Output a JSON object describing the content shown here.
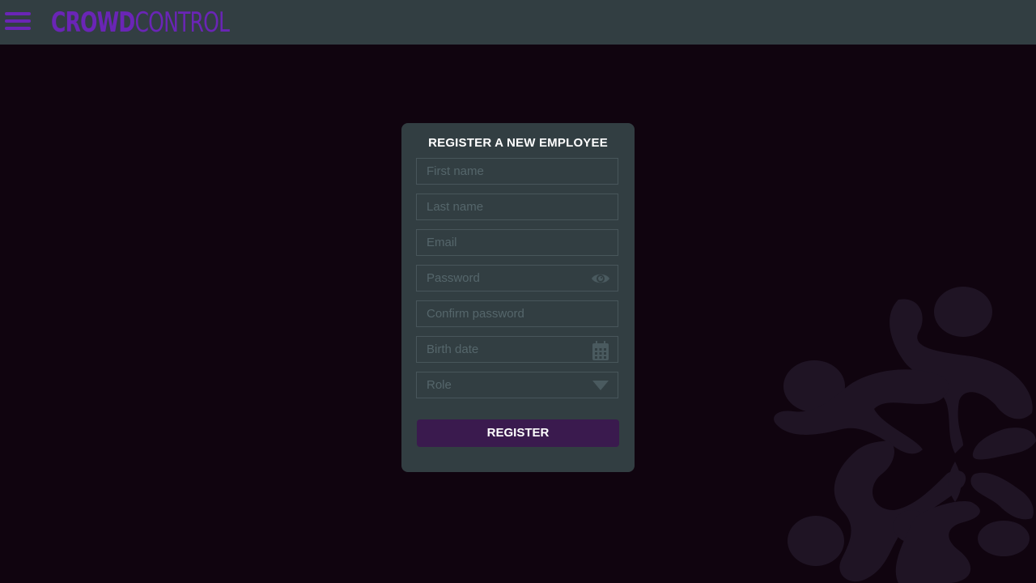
{
  "header": {
    "logo_bold": "CROWD",
    "logo_light": "CONTROL"
  },
  "form": {
    "title": "REGISTER A NEW EMPLOYEE",
    "first_name_placeholder": "First name",
    "last_name_placeholder": "Last name",
    "email_placeholder": "Email",
    "password_placeholder": "Password",
    "confirm_password_placeholder": "Confirm password",
    "birth_date_placeholder": "Birth date",
    "role_placeholder": "Role",
    "submit_label": "REGISTER"
  },
  "icons": {
    "menu": "hamburger-icon",
    "password_toggle": "eye-icon",
    "birth_date": "calendar-icon",
    "role_dropdown": "triangle-down-icon"
  },
  "colors": {
    "page_background": "#10040f",
    "topbar": "#323e42",
    "brand_purple": "#6a25b6",
    "card": "#323e42",
    "button": "#3a1a4e",
    "emblem": "#1f1424"
  }
}
